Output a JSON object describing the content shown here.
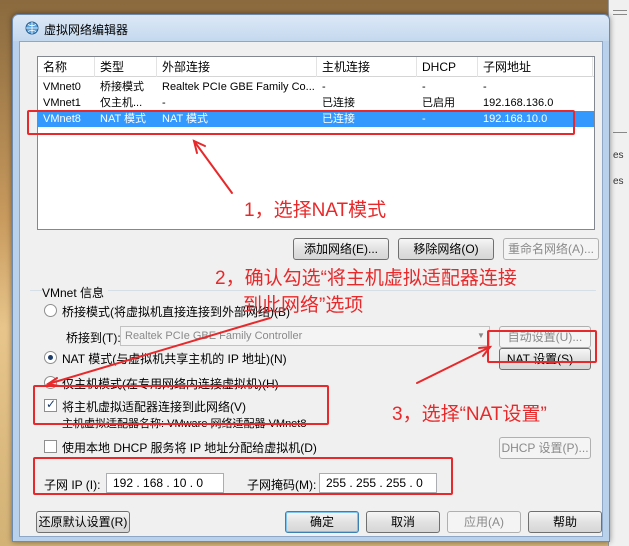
{
  "window": {
    "title": "虚拟网络编辑器"
  },
  "list": {
    "headers": [
      "名称",
      "类型",
      "外部连接",
      "主机连接",
      "DHCP",
      "子网地址"
    ],
    "rows": [
      {
        "name": "VMnet0",
        "type": "桥接模式",
        "external": "Realtek PCIe GBE Family Co...",
        "host": "-",
        "dhcp": "-",
        "subnet": "-",
        "selected": false
      },
      {
        "name": "VMnet1",
        "type": "仅主机...",
        "external": "-",
        "host": "已连接",
        "dhcp": "已启用",
        "subnet": "192.168.136.0",
        "selected": false
      },
      {
        "name": "VMnet8",
        "type": "NAT 模式",
        "external": "NAT 模式",
        "host": "已连接",
        "dhcp": "-",
        "subnet": "192.168.10.0",
        "selected": true
      }
    ]
  },
  "list_buttons": {
    "add": "添加网络(E)...",
    "remove": "移除网络(O)",
    "rename": "重命名网络(A)..."
  },
  "vmnet_info": {
    "group_title": "VMnet 信息",
    "bridge_radio": "桥接模式(将虚拟机直接连接到外部网络)(B)",
    "bridge_to_label": "桥接到(T):",
    "bridge_to_value": "Realtek PCIe GBE Family Controller",
    "auto_settings": "自动设置(U)...",
    "nat_radio": "NAT 模式(与虚拟机共享主机的 IP 地址)(N)",
    "nat_settings": "NAT 设置(S)...",
    "hostonly_radio": "仅主机模式(在专用网络内连接虚拟机)(H)",
    "connect_adapter_check": "将主机虚拟适配器连接到此网络(V)",
    "adapter_name": "主机虚拟适配器名称: VMware 网络适配器 VMnet8",
    "dhcp_check": "使用本地 DHCP 服务将 IP 地址分配给虚拟机(D)",
    "dhcp_settings": "DHCP 设置(P)...",
    "subnet_ip_label": "子网 IP (I):",
    "subnet_ip_value": "192 . 168 . 10 . 0",
    "subnet_mask_label": "子网掩码(M):",
    "subnet_mask_value": "255 . 255 . 255 . 0"
  },
  "footer": {
    "restore": "还原默认设置(R)",
    "ok": "确定",
    "cancel": "取消",
    "apply": "应用(A)",
    "help": "帮助"
  },
  "annotations": {
    "step1": "1，选择NAT模式",
    "step2_line1": "2，确认勾选“将主机虚拟适配器连接",
    "step2_line2": "到此网络”选项",
    "step3": "3，选择“NAT设置”",
    "color": "#e8292b"
  },
  "background_right": {
    "text1": "es",
    "text2": "es"
  }
}
